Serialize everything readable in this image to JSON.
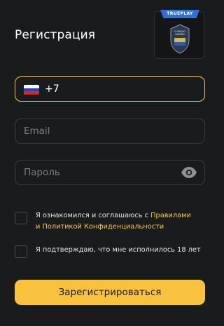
{
  "header": {
    "title": "Регистрация"
  },
  "badge": {
    "ribbon_text": "TRUEPLAY",
    "seal_text": "CURAÇAO\nGAMING"
  },
  "form": {
    "phone": {
      "country_flag_icon": "russia-flag-icon",
      "prefix": "+7"
    },
    "email": {
      "placeholder": "Email"
    },
    "password": {
      "placeholder": "Пароль",
      "toggle_icon": "eye-icon"
    },
    "agree_terms": {
      "text_before": "Я ознакомился и соглашаюсь с ",
      "rules_link": "Правилами",
      "text_middle": " и ",
      "policy_link": "Политикой Конфиденциальности",
      "checked": false
    },
    "age_confirm": {
      "text": "Я подтверждаю, что мне исполнилось 18 лет",
      "checked": false
    },
    "submit_label": "Зарегистрироваться"
  },
  "colors": {
    "background": "#1a1b1d",
    "accent": "#f5c642",
    "field_border": "#3a3b40",
    "ribbon": "#2f6fd6"
  }
}
